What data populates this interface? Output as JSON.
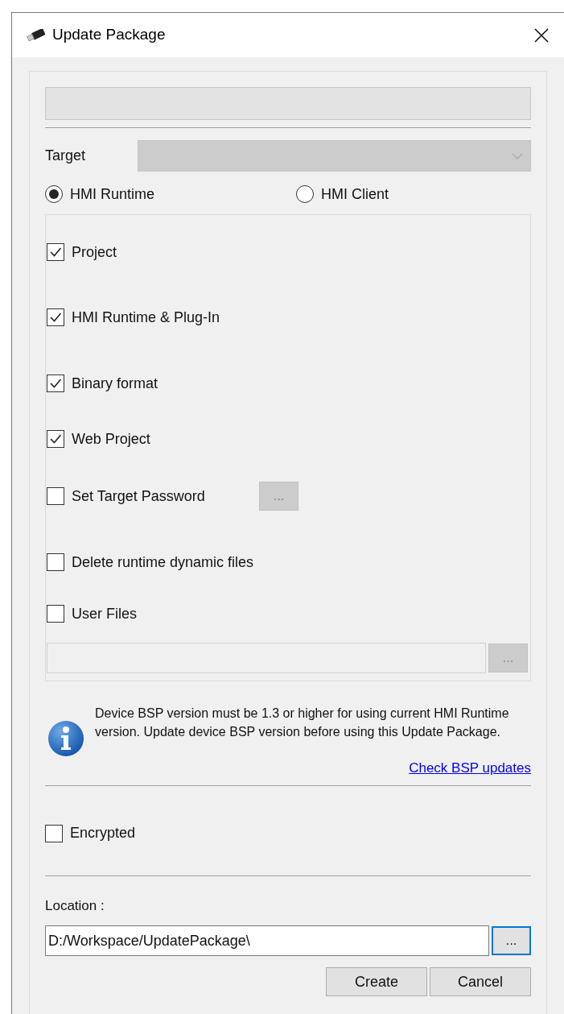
{
  "window": {
    "title": "Update Package"
  },
  "name_field": {
    "disabled": true
  },
  "target": {
    "label": "Target",
    "disabled": true
  },
  "modes": [
    {
      "label": "HMI Runtime",
      "selected": true
    },
    {
      "label": "HMI Client",
      "selected": false
    }
  ],
  "options": [
    {
      "kind": "checkbox",
      "label": "Project",
      "checked": true
    },
    {
      "kind": "checkbox",
      "label": "HMI Runtime & Plug-In",
      "checked": true
    },
    {
      "kind": "checkbox",
      "label": "Binary format",
      "checked": true
    },
    {
      "kind": "checkbox",
      "label": "Web Project",
      "checked": true
    },
    {
      "kind": "checkbox-browse",
      "label": "Set Target Password",
      "checked": false,
      "button": {
        "label": "...",
        "disabled": true
      }
    },
    {
      "kind": "checkbox",
      "label": "Delete runtime dynamic files",
      "checked": false
    },
    {
      "kind": "checkbox",
      "label": "User Files",
      "checked": false
    }
  ],
  "user_files_path": {
    "disabled": true,
    "button": {
      "label": "...",
      "disabled": true
    }
  },
  "info": {
    "message": "Device BSP version must be 1.3 or higher for using current HMI Runtime version. Update device BSP version before using this Update Package.",
    "link": "Check BSP updates"
  },
  "encrypted": {
    "label": "Encrypted",
    "checked": false
  },
  "location": {
    "label": "Location :",
    "value": "D:/Workspace/UpdatePackage\\",
    "button": {
      "label": "...",
      "focused": true
    }
  },
  "buttons": [
    "Create",
    "Cancel"
  ]
}
